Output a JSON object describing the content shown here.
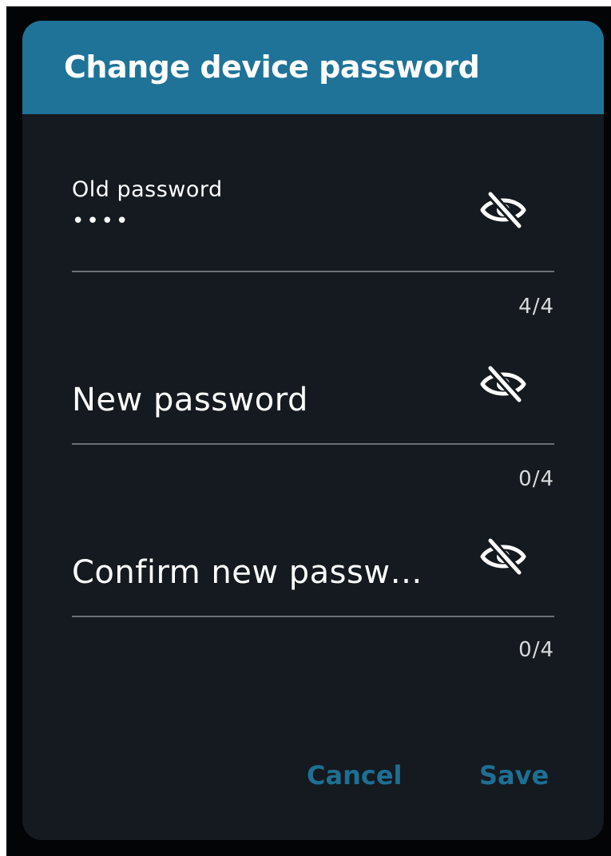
{
  "dialog": {
    "title": "Change device password",
    "header_color": "#1f7398",
    "background_color": "#141a1f"
  },
  "fields": [
    {
      "label": "Old password",
      "value": "••••",
      "counter": "4/4",
      "toggle_icon": "eye-off-icon"
    },
    {
      "label": "New password",
      "value": "",
      "counter": "0/4",
      "toggle_icon": "eye-off-icon"
    },
    {
      "label": "Confirm new passw…",
      "value": "",
      "counter": "0/4",
      "toggle_icon": "eye-off-icon"
    }
  ],
  "actions": {
    "cancel_label": "Cancel",
    "save_label": "Save",
    "accent_color": "#1e6f93"
  }
}
